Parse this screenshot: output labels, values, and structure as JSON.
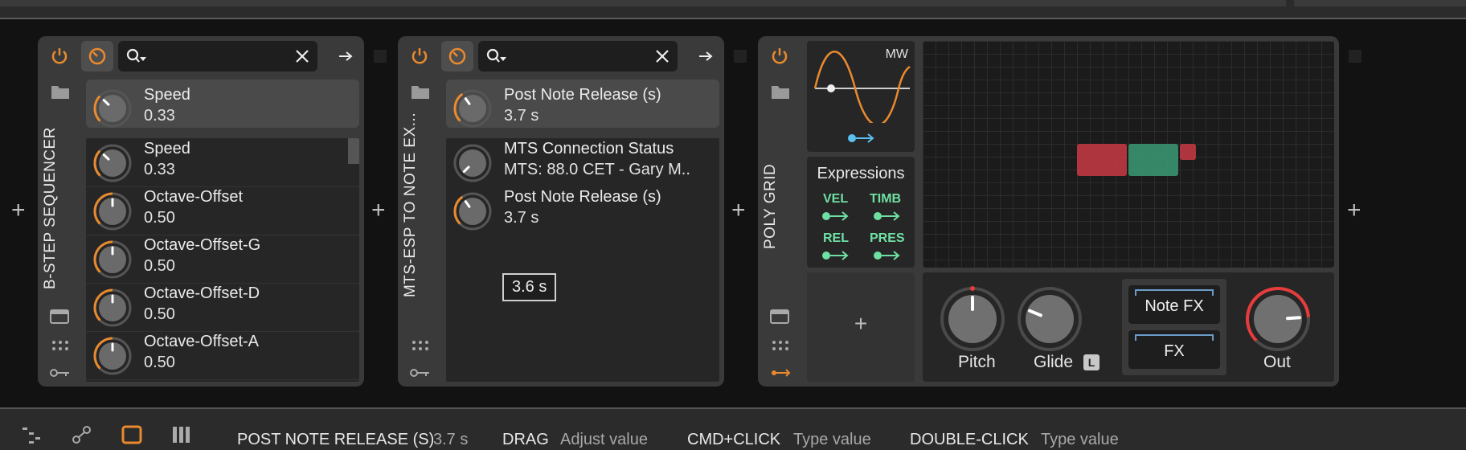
{
  "colors": {
    "accent_orange": "#e98a2e",
    "accent_green": "#6fe0a4",
    "accent_blue": "#5bc0f0",
    "accent_red": "#e83b3b"
  },
  "devices": [
    {
      "title": "B-STEP SEQUENCER",
      "selected_param": {
        "name": "Speed",
        "value": "0.33",
        "knob_fraction": 0.33
      },
      "params": [
        {
          "name": "Speed",
          "value": "0.33",
          "knob_fraction": 0.33
        },
        {
          "name": "Octave-Offset",
          "value": "0.50",
          "knob_fraction": 0.5
        },
        {
          "name": "Octave-Offset-G",
          "value": "0.50",
          "knob_fraction": 0.5
        },
        {
          "name": "Octave-Offset-D",
          "value": "0.50",
          "knob_fraction": 0.5
        },
        {
          "name": "Octave-Offset-A",
          "value": "0.50",
          "knob_fraction": 0.5
        }
      ]
    },
    {
      "title": "MTS-ESP TO NOTE EX...",
      "selected_param": {
        "name": "Post Note Release (s)",
        "value": "3.7 s",
        "knob_fraction": 0.37
      },
      "params": [
        {
          "name": "MTS Connection Status",
          "value": "MTS: 88.0 CET - Gary M..",
          "knob_fraction": 0
        },
        {
          "name": "Post Note Release (s)",
          "value": "3.7 s",
          "knob_fraction": 0.37
        }
      ],
      "tooltip": "3.6 s"
    },
    {
      "title": "POLY GRID",
      "lfo_label": "MW",
      "expressions": {
        "title": "Expressions",
        "items": [
          "VEL",
          "TIMB",
          "REL",
          "PRES"
        ]
      },
      "controls": [
        {
          "label": "Pitch",
          "knob_fraction": 0.5
        },
        {
          "label": "Glide",
          "knob_fraction": 0.25,
          "badge": "L"
        },
        {
          "label": "Out",
          "knob_fraction": 0.82
        }
      ],
      "fx_buttons": [
        "Note FX",
        "FX"
      ]
    }
  ],
  "add_symbol": "+",
  "statusbar": {
    "param_key": "POST NOTE RELEASE (S)",
    "param_value": "3.7 s",
    "hints": [
      {
        "key": "DRAG",
        "value": "Adjust value"
      },
      {
        "key": "CMD+CLICK",
        "value": "Type value"
      },
      {
        "key": "DOUBLE-CLICK",
        "value": "Type value"
      }
    ]
  }
}
